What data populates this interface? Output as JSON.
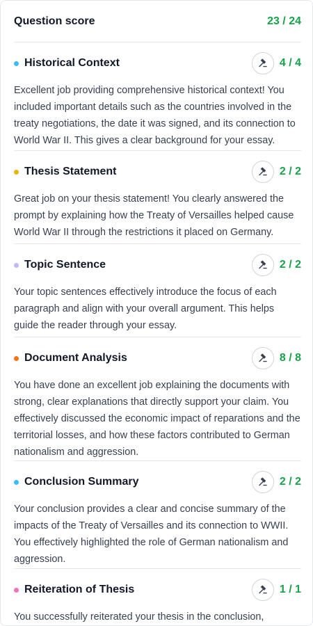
{
  "header": {
    "title": "Question score",
    "score": "23 / 24"
  },
  "colors": {
    "score_green": "#16a34a",
    "dot_blue": "#38bdf8",
    "dot_yellow": "#eab308",
    "dot_lavender": "#c4b5fd",
    "dot_orange": "#f97316",
    "dot_pink": "#f472b6"
  },
  "sections": [
    {
      "title": "Historical Context",
      "score": "4 / 4",
      "icon": "gavel-icon",
      "text": "Excellent job providing comprehensive historical context! You included important details such as the countries involved in the treaty negotiations, the date it was signed, and its connection to World War II. This gives a clear background for your essay."
    },
    {
      "title": "Thesis Statement",
      "score": "2 / 2",
      "icon": "gavel-icon",
      "text": "Great job on your thesis statement! You clearly answered the prompt by explaining how the Treaty of Versailles helped cause World War II through the restrictions it placed on Germany."
    },
    {
      "title": "Topic Sentence",
      "score": "2 / 2",
      "icon": "gavel-icon",
      "text": "Your topic sentences effectively introduce the focus of each paragraph and align with your overall argument. This helps guide the reader through your essay."
    },
    {
      "title": "Document Analysis",
      "score": "8 / 8",
      "icon": "gavel-icon",
      "text": "You have done an excellent job explaining the documents with strong, clear explanations that directly support your claim. You effectively discussed the economic impact of reparations and the territorial losses, and how these factors contributed to German nationalism and aggression."
    },
    {
      "title": "Conclusion Summary",
      "score": "2 / 2",
      "icon": "gavel-icon",
      "text": "Your conclusion provides a clear and concise summary of the impacts of the Treaty of Versailles and its connection to WWII. You effectively highlighted the role of German nationalism and aggression."
    },
    {
      "title": "Reiteration of Thesis",
      "score": "1 / 1",
      "icon": "gavel-icon",
      "text": "You successfully reiterated your thesis in the conclusion, reinforcing"
    }
  ]
}
